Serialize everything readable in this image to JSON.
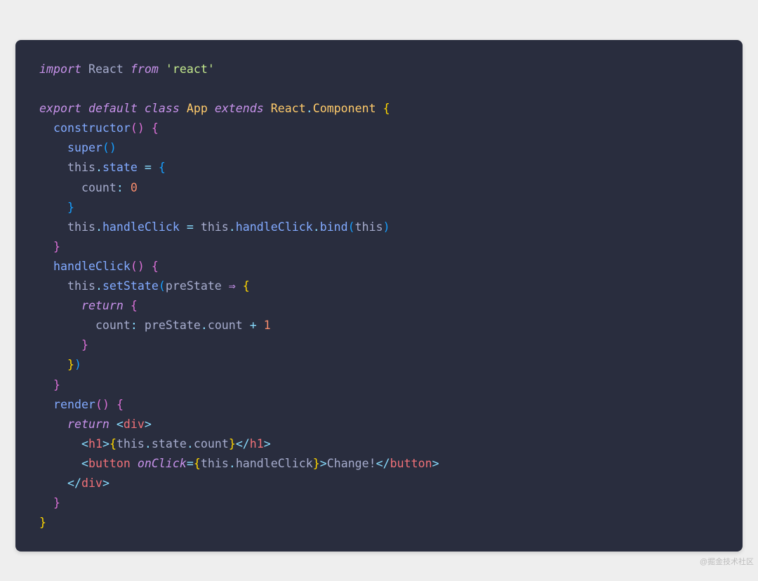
{
  "watermark": "@掘金技术社区",
  "tokens": {
    "l1": {
      "import": "import",
      "react": "React",
      "from": "from",
      "str": "'react'"
    },
    "l3": {
      "export": "export",
      "default": "default",
      "class": "class",
      "app": "App",
      "extends": "extends",
      "reactc": "React",
      "dot": ".",
      "component": "Component",
      "sp": " ",
      "ob": "{"
    },
    "l4": {
      "ctor": "constructor",
      "lp": "(",
      "rp": ")",
      "sp": " ",
      "ob": "{"
    },
    "l5": {
      "super": "super",
      "lp": "(",
      "rp": ")"
    },
    "l6": {
      "this": "this",
      "dot": ".",
      "state": "state",
      "eq": " = ",
      "ob": "{"
    },
    "l7": {
      "count": "count",
      "colon": ":",
      "sp": " ",
      "zero": "0"
    },
    "l8": {
      "cb": "}"
    },
    "l9": {
      "this": "this",
      "dot": ".",
      "hc": "handleClick",
      "eq": " = ",
      "this2": "this",
      "dot2": ".",
      "hc2": "handleClick",
      "dot3": ".",
      "bind": "bind",
      "lp": "(",
      "this3": "this",
      "rp": ")"
    },
    "l10": {
      "cb": "}"
    },
    "l11": {
      "hc": "handleClick",
      "lp": "(",
      "rp": ")",
      "sp": " ",
      "ob": "{"
    },
    "l12": {
      "this": "this",
      "dot": ".",
      "ss": "setState",
      "lp": "(",
      "ps": "preState",
      "arrow": " ⇒ ",
      "ob": "{"
    },
    "l13": {
      "return": "return",
      "sp": " ",
      "ob": "{"
    },
    "l14": {
      "count": "count",
      "colon": ":",
      "sp": " ",
      "ps": "preState",
      "dot": ".",
      "cnt": "count",
      "plus": " + ",
      "one": "1"
    },
    "l15": {
      "cb": "}"
    },
    "l16": {
      "cb": "}",
      "rp": ")"
    },
    "l17": {
      "cb": "}"
    },
    "l18": {
      "render": "render",
      "lp": "(",
      "rp": ")",
      "sp": " ",
      "ob": "{"
    },
    "l19": {
      "return": "return",
      "sp": " ",
      "lt": "<",
      "div": "div",
      "gt": ">"
    },
    "l20": {
      "lt": "<",
      "h1": "h1",
      "gt": ">",
      "ob": "{",
      "this": "this",
      "d1": ".",
      "state": "state",
      "d2": ".",
      "count": "count",
      "cb": "}",
      "lt2": "</",
      "h1b": "h1",
      "gt2": ">"
    },
    "l21": {
      "lt": "<",
      "button": "button",
      "sp": " ",
      "onclick": "onClick",
      "eq": "=",
      "ob": "{",
      "this": "this",
      "dot": ".",
      "hc": "handleClick",
      "cb": "}",
      "gt": ">",
      "text": "Change!",
      "lt2": "</",
      "buttonb": "button",
      "gt2": ">"
    },
    "l22": {
      "lt": "</",
      "div": "div",
      "gt": ">"
    },
    "l23": {
      "cb": "}"
    },
    "l24": {
      "cb": "}"
    }
  }
}
